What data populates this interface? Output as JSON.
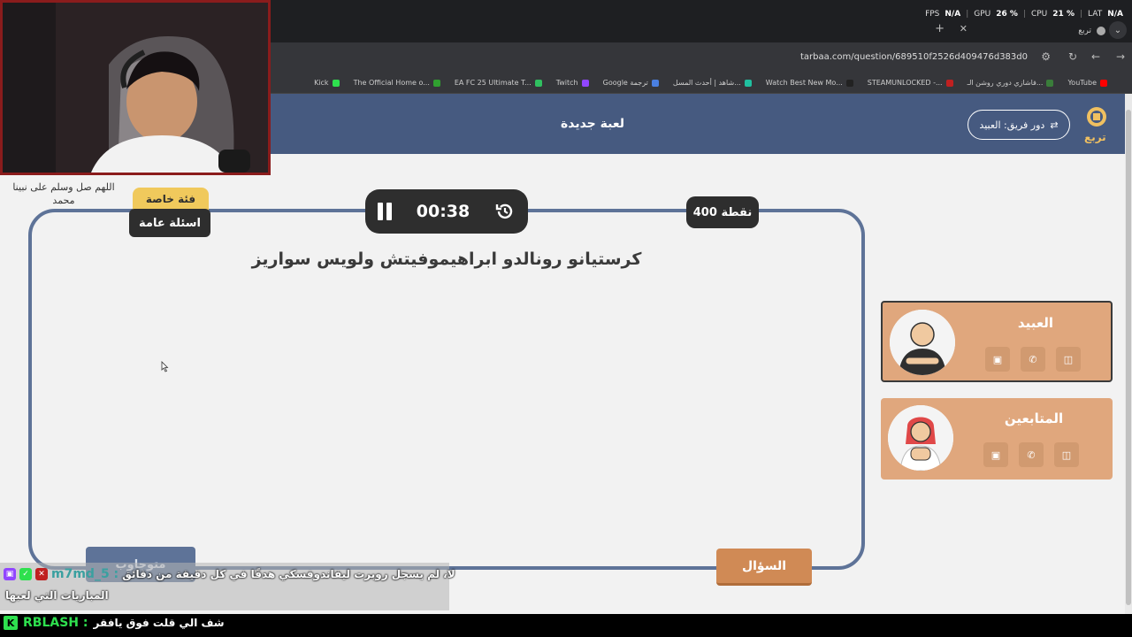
{
  "perf": {
    "fps_label": "FPS",
    "fps_value": "N/A",
    "gpu_label": "GPU",
    "gpu_value": "26 %",
    "cpu_label": "CPU",
    "cpu_value": "21 %",
    "lat_label": "LAT",
    "lat_value": "N/A"
  },
  "browser": {
    "tab_title": "تربع",
    "url": "tarbaa.com/question/689510f2526d409476d383d0",
    "bookmarks": [
      {
        "label": "YouTube",
        "color": "#ff0000"
      },
      {
        "label": "فاشازي دوري روشن الـ...",
        "color": "#3a7d3a"
      },
      {
        "label": "STEAMUNLOCKED -...",
        "color": "#c02020"
      },
      {
        "label": "Watch Best New Mo...",
        "color": "#222222"
      },
      {
        "label": "شاهد | أحدث المسل...",
        "color": "#20c0a0"
      },
      {
        "label": "Google ترجمة",
        "color": "#4a7fe0"
      },
      {
        "label": "Twitch",
        "color": "#9146ff"
      },
      {
        "label": "EA FC 25 Ultimate T...",
        "color": "#30c060"
      },
      {
        "label": "The Official Home o...",
        "color": "#30a030"
      },
      {
        "label": "Kick",
        "color": "#2ee04e"
      }
    ]
  },
  "header": {
    "title": "لعبة جديدة",
    "turn_label": "دور فريق: العبيد",
    "logo_text": "تربع",
    "bg_color": "#465a80"
  },
  "game": {
    "timer": "00:38",
    "points": "400 نقطة",
    "category_special": "فئة خاصة",
    "category_general": "اسئلة عامة",
    "question_text": "كرستيانو رونالدو ابراهيموفيتش ولويس سواريز",
    "question_button": "السؤال",
    "answer_button": "متوجاوب"
  },
  "teams": [
    {
      "name": "العبيد",
      "active": true
    },
    {
      "name": "المتابعين",
      "active": false
    }
  ],
  "overlay": {
    "prayer_caption": "اللهم صل وسلم على نبينا محمد",
    "chat_user": "m7md_5 :",
    "chat_message": "لا، لم يسجل روبرت ليفاندوفسكي هدفًا في كل دقيقة من دقائق",
    "chat_message_2": "المباريات التي لعبها",
    "bottom_user": "RBLASH :",
    "bottom_message": "شف الي قلت فوق يافقر"
  }
}
